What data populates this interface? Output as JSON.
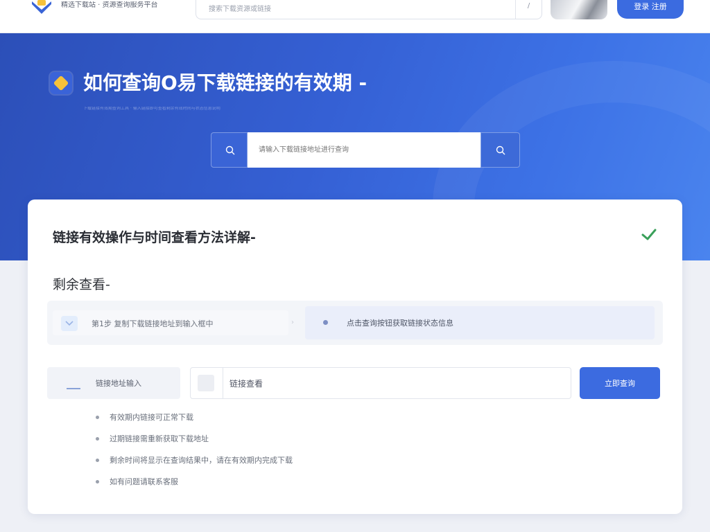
{
  "header": {
    "brand_text": "精选下载站 · 资源查询服务平台",
    "search_placeholder": "搜索下载资源或链接",
    "search_shortcut": "/",
    "login_label": "登录 注册"
  },
  "hero": {
    "title": "如何查询O易下载链接的有效期 -",
    "subtitle": "下载链接有效期查询工具 · 输入链接即可查看剩余有效时间与状态信息说明",
    "search_placeholder": "请输入下载链接地址进行查询"
  },
  "card": {
    "title": "链接有效操作与时间查看方法详解-",
    "section_title": "剩余查看-",
    "step1_text": "第1步 复制下载链接地址到输入框中",
    "step2_text": "点击查询按钮获取链接状态信息",
    "field_left_text": "链接地址输入",
    "field_mid_text": "链接查看",
    "query_button": "立即查询",
    "bullets": [
      "有效期内链接可正常下载",
      "过期链接需重新获取下载地址",
      "剩余时间将显示在查询结果中，请在有效期内完成下载",
      "如有问题请联系客服"
    ]
  },
  "colors": {
    "accent": "#3c6be0",
    "hero_start": "#2c4fb8",
    "hero_end": "#4a84ee",
    "check_green": "#3aa05a",
    "logo_yellow": "#f7c23a"
  }
}
